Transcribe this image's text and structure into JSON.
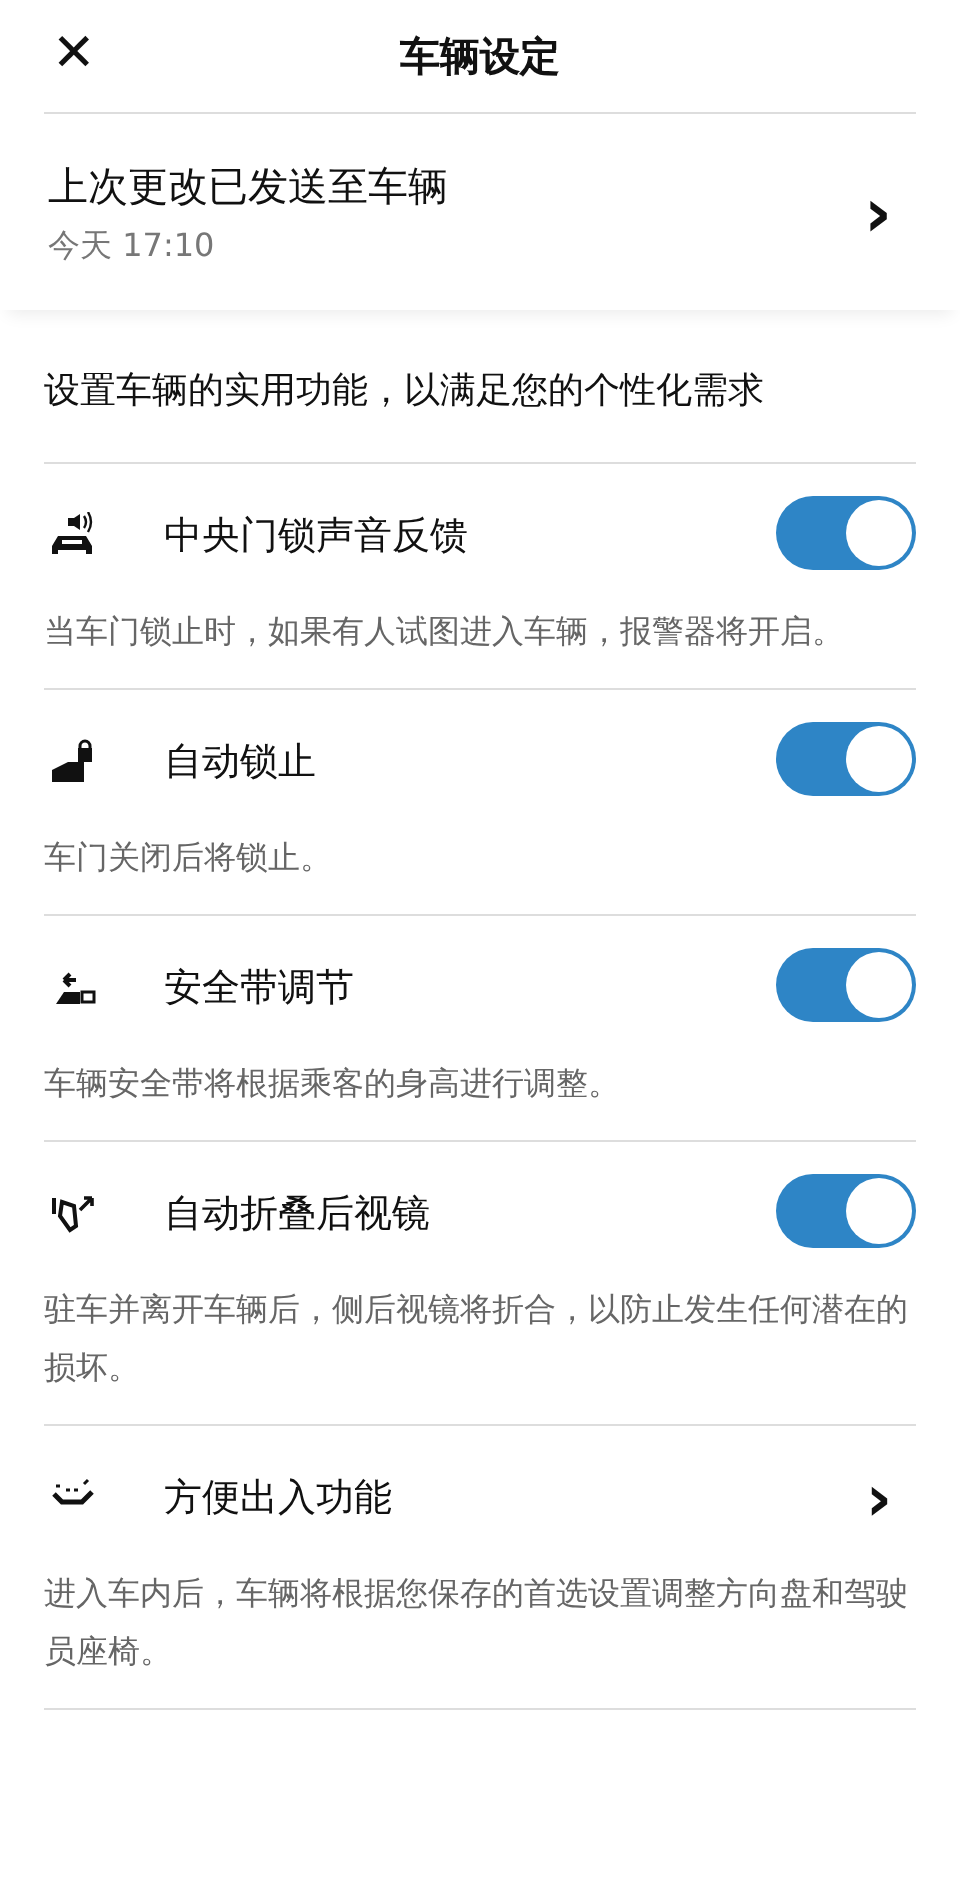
{
  "header": {
    "close_icon": "✕",
    "title": "车辆设定"
  },
  "last_sent": {
    "title": "上次更改已发送至车辆",
    "time": "今天 17:10",
    "chevron": "›"
  },
  "intro": "设置车辆的实用功能，以满足您的个性化需求",
  "settings": [
    {
      "kind": "toggle",
      "title": "中央门锁声音反馈",
      "on": true,
      "description": "当车门锁止时，如果有人试图进入车辆，报警器将开启。"
    },
    {
      "kind": "toggle",
      "title": "自动锁止",
      "on": true,
      "description": "车门关闭后将锁止。"
    },
    {
      "kind": "toggle",
      "title": "安全带调节",
      "on": true,
      "description": "车辆安全带将根据乘客的身高进行调整。"
    },
    {
      "kind": "toggle",
      "title": "自动折叠后视镜",
      "on": true,
      "description": "驻车并离开车辆后，侧后视镜将折合，以防止发生任何潜在的损坏。"
    },
    {
      "kind": "link",
      "title": "方便出入功能",
      "chevron": "›",
      "description": "进入车内后，车辆将根据您保存的首选设置调整方向盘和驾驶员座椅。"
    }
  ]
}
